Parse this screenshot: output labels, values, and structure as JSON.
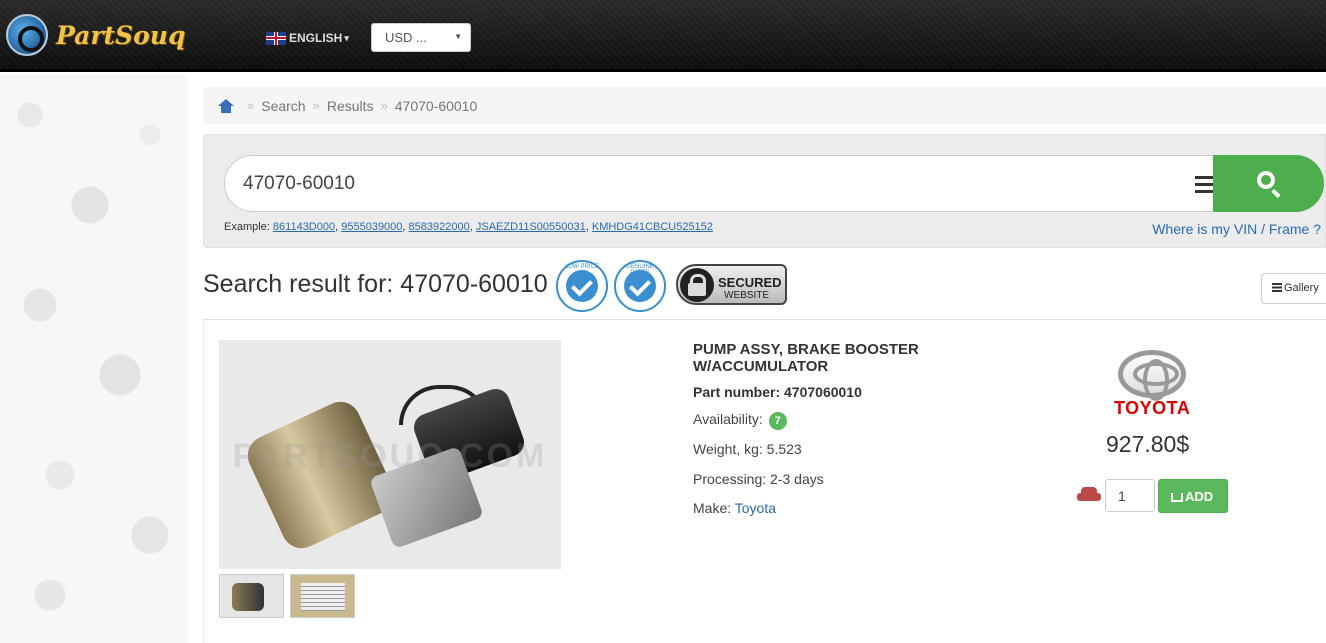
{
  "header": {
    "logo_text": "PartSouq",
    "language": "ENGLISH",
    "currency": "USD ..."
  },
  "breadcrumb": {
    "items": [
      "Search",
      "Results",
      "47070-60010"
    ]
  },
  "search": {
    "value": "47070-60010",
    "example_label": "Example:",
    "examples": [
      "861143D000",
      "9555039000",
      "8583922000",
      "JSAEZD11S00550031",
      "KMHDG41CBCU525152"
    ],
    "vin_link": "Where is my VIN / Frame ?"
  },
  "results": {
    "title": "Search result for: 47070-60010",
    "badges": {
      "low_price": "LOW PRICE",
      "genuine": "GENUINE PARTS",
      "secured_line1": "SECURED",
      "secured_line2": "WEBSITE"
    },
    "view_toggle": "Gallery"
  },
  "product": {
    "name": "PUMP ASSY, BRAKE BOOSTER W/ACCUMULATOR",
    "part_number_label": "Part number:",
    "part_number": "4707060010",
    "availability_label": "Availability:",
    "availability": "7",
    "weight_label": "Weight, kg:",
    "weight": "5.523",
    "processing_label": "Processing:",
    "processing": "2-3 days",
    "make_label": "Make:",
    "make": "Toyota",
    "brand_logo_text": "TOYOTA",
    "price": "927.80$",
    "quantity": "1",
    "add_label": "ADD",
    "watermark": "PARTSOUQ.COM"
  },
  "colors": {
    "accent_green": "#5cb85c",
    "link_blue": "#2a6ab0",
    "brand_red": "#d00000"
  }
}
